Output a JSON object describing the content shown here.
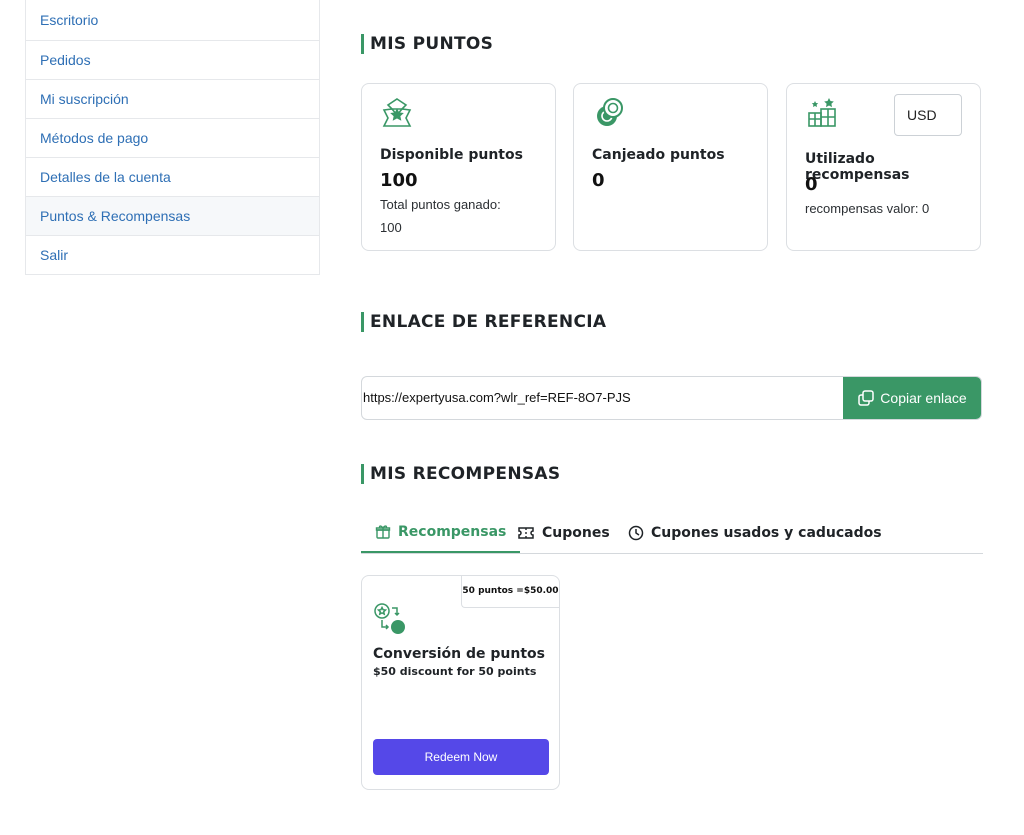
{
  "sidebar": {
    "items": [
      {
        "label": "Escritorio"
      },
      {
        "label": "Pedidos"
      },
      {
        "label": "Mi suscripción"
      },
      {
        "label": "Métodos de pago"
      },
      {
        "label": "Detalles de la cuenta"
      },
      {
        "label": "Puntos & Recompensas",
        "active": true
      },
      {
        "label": "Salir"
      }
    ]
  },
  "points_section": {
    "title": "MIS PUNTOS",
    "available": {
      "label": "Disponible puntos",
      "value": "100",
      "total_label": "Total puntos ganado:",
      "total_value": "100",
      "icon": "badge-star-icon"
    },
    "redeemed": {
      "label": "Canjeado puntos",
      "value": "0",
      "icon": "coins-icon"
    },
    "used": {
      "label": "Utilizado recompensas",
      "value": "0",
      "sub": "recompensas valor: 0",
      "currency": "USD",
      "icon": "gift-boxes-icon"
    }
  },
  "referral": {
    "title": "ENLACE DE REFERENCIA",
    "link": "https://expertyusa.com?wlr_ref=REF-8O7-PJS",
    "copy_label": "Copiar enlace"
  },
  "rewards": {
    "title": "MIS RECOMPENSAS",
    "tabs": [
      {
        "label": "Recompensas",
        "icon": "gift-icon",
        "active": true
      },
      {
        "label": "Cupones",
        "icon": "ticket-icon"
      },
      {
        "label": "Cupones usados y caducados",
        "icon": "clock-icon"
      }
    ],
    "card": {
      "badge": "50 puntos =$50.00",
      "title": "Conversión de puntos",
      "description": "$50 discount for 50 points",
      "button": "Redeem Now",
      "icon": "points-conversion-icon"
    }
  },
  "colors": {
    "accent": "#3a9766",
    "link": "#2e6fb5",
    "button": "#5548e8"
  }
}
